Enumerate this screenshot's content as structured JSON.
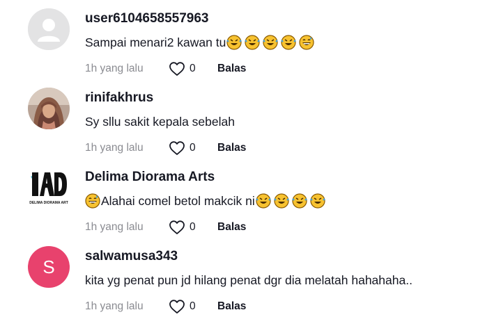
{
  "comments": [
    {
      "username": "user6104658557963",
      "text": "Sampai menari2 kawan tu",
      "trailing_emojis": [
        "rofl-emoji",
        "rofl-emoji",
        "rofl-emoji",
        "rofl-emoji",
        "grin-sweat-emoji"
      ],
      "time": "1h yang lalu",
      "likes": "0",
      "reply_label": "Balas",
      "avatar": "default-avatar"
    },
    {
      "username": "rinifakhrus",
      "text": "Sy sllu sakit kepala sebelah",
      "time": "1h yang lalu",
      "likes": "0",
      "reply_label": "Balas",
      "avatar": "photo-avatar"
    },
    {
      "username": "Delima Diorama Arts",
      "text": "Alahai comel betol makcik ni",
      "leading_emojis": [
        "grin-sweat-emoji"
      ],
      "trailing_emojis": [
        "rofl-emoji",
        "rofl-emoji",
        "rofl-emoji",
        "rofl-emoji"
      ],
      "time": "1h yang lalu",
      "likes": "0",
      "reply_label": "Balas",
      "avatar": "logo-avatar",
      "logo_text": "DELIMA DIORAMA ART"
    },
    {
      "username": "salwamusa343",
      "text": "kita yg penat pun jd hilang penat dgr dia melatah hahahaha..",
      "time": "1h yang lalu",
      "likes": "0",
      "reply_label": "Balas",
      "avatar": "letter-avatar",
      "avatar_letter": "S"
    }
  ],
  "colors": {
    "meta_gray": "#8a8b91",
    "avatar_pink": "#e8426d",
    "text_dark": "#161823"
  }
}
